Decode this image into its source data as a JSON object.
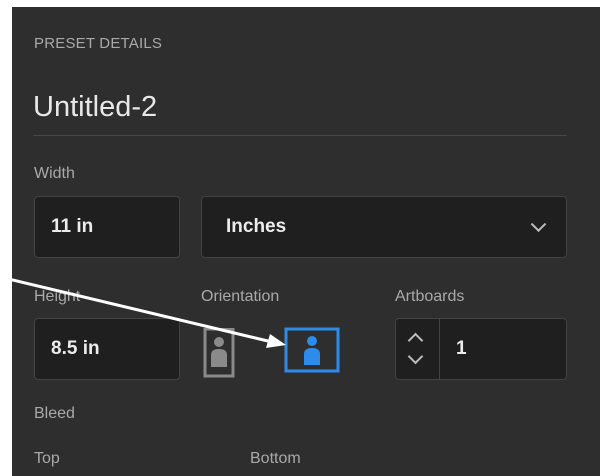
{
  "panel": {
    "section_header": "PRESET DETAILS",
    "document_name": "Untitled-2"
  },
  "width": {
    "label": "Width",
    "value": "11 in",
    "units_selected": "Inches"
  },
  "height": {
    "label": "Height",
    "value": "8.5 in"
  },
  "orientation": {
    "label": "Orientation",
    "selected": "landscape"
  },
  "artboards": {
    "label": "Artboards",
    "value": "1"
  },
  "bleed": {
    "label": "Bleed",
    "top_label": "Top",
    "bottom_label": "Bottom"
  },
  "colors": {
    "panel_bg": "#2e2e2e",
    "field_bg": "#1f1f1f",
    "accent": "#2d8ceb",
    "annotation_arrow": "#ffffff"
  },
  "icons": {
    "portrait": "portrait-orientation-icon",
    "landscape": "landscape-orientation-icon",
    "units_dropdown": "chevron-down-icon",
    "stepper": "stepper-arrows-icon"
  }
}
